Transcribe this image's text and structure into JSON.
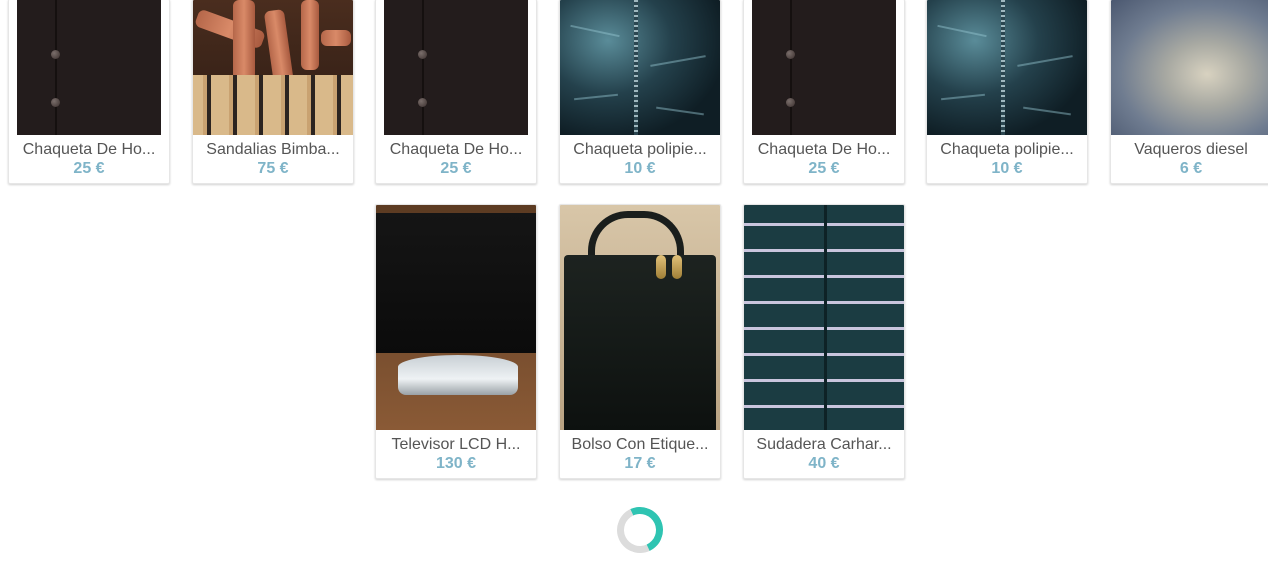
{
  "products": [
    {
      "title": "Chaqueta De Ho...",
      "price": "25 €",
      "art": "vest"
    },
    {
      "title": "Sandalias Bimba...",
      "price": "75 €",
      "art": "sandal"
    },
    {
      "title": "Chaqueta De Ho...",
      "price": "25 €",
      "art": "vest"
    },
    {
      "title": "Chaqueta polipie...",
      "price": "10 €",
      "art": "leather"
    },
    {
      "title": "Chaqueta De Ho...",
      "price": "25 €",
      "art": "vest"
    },
    {
      "title": "Chaqueta polipie...",
      "price": "10 €",
      "art": "leather"
    },
    {
      "title": "Vaqueros diesel",
      "price": "6 €",
      "art": "jeans"
    },
    {
      "title": "Televisor LCD H...",
      "price": "130 €",
      "art": "tv"
    },
    {
      "title": "Bolso Con Etique...",
      "price": "17 €",
      "art": "bag"
    },
    {
      "title": "Sudadera Carhar...",
      "price": "40 €",
      "art": "stripe"
    }
  ],
  "colors": {
    "price": "#7fb4c8",
    "title": "#555555",
    "spinner_active": "#2fc4b2",
    "spinner_track": "#dcdcdc"
  },
  "loading_indicator": "spinner-icon"
}
